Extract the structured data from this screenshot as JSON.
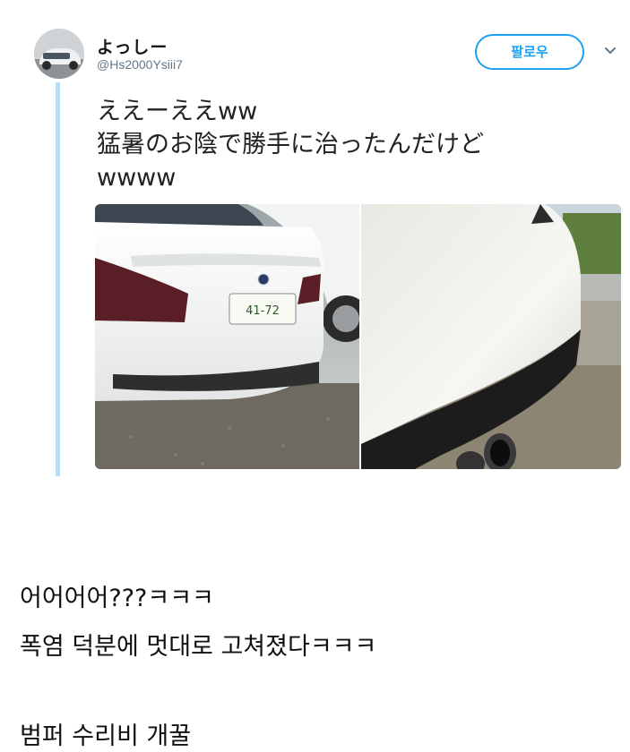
{
  "tweet": {
    "display_name": "よっしー",
    "handle": "@Hs2000Ysiii7",
    "follow_label": "팔로우",
    "text": "ええーええww\n猛暑のお陰で勝手に治ったんだけど\nwwww",
    "photos": [
      {
        "alt": "white BMW rear with license plate",
        "plate": "41-72"
      },
      {
        "alt": "close-up of smooth rear bumper"
      }
    ]
  },
  "caption": {
    "line1": "어어어어???ㅋㅋㅋ",
    "line2": "폭염 덕분에 멋대로 고쳐졌다ㅋㅋㅋ",
    "line3": "범퍼 수리비 개꿀"
  },
  "colors": {
    "accent": "#1da1f2",
    "thread": "#b8def5"
  },
  "icons": {
    "more": "chevron-down-icon"
  }
}
